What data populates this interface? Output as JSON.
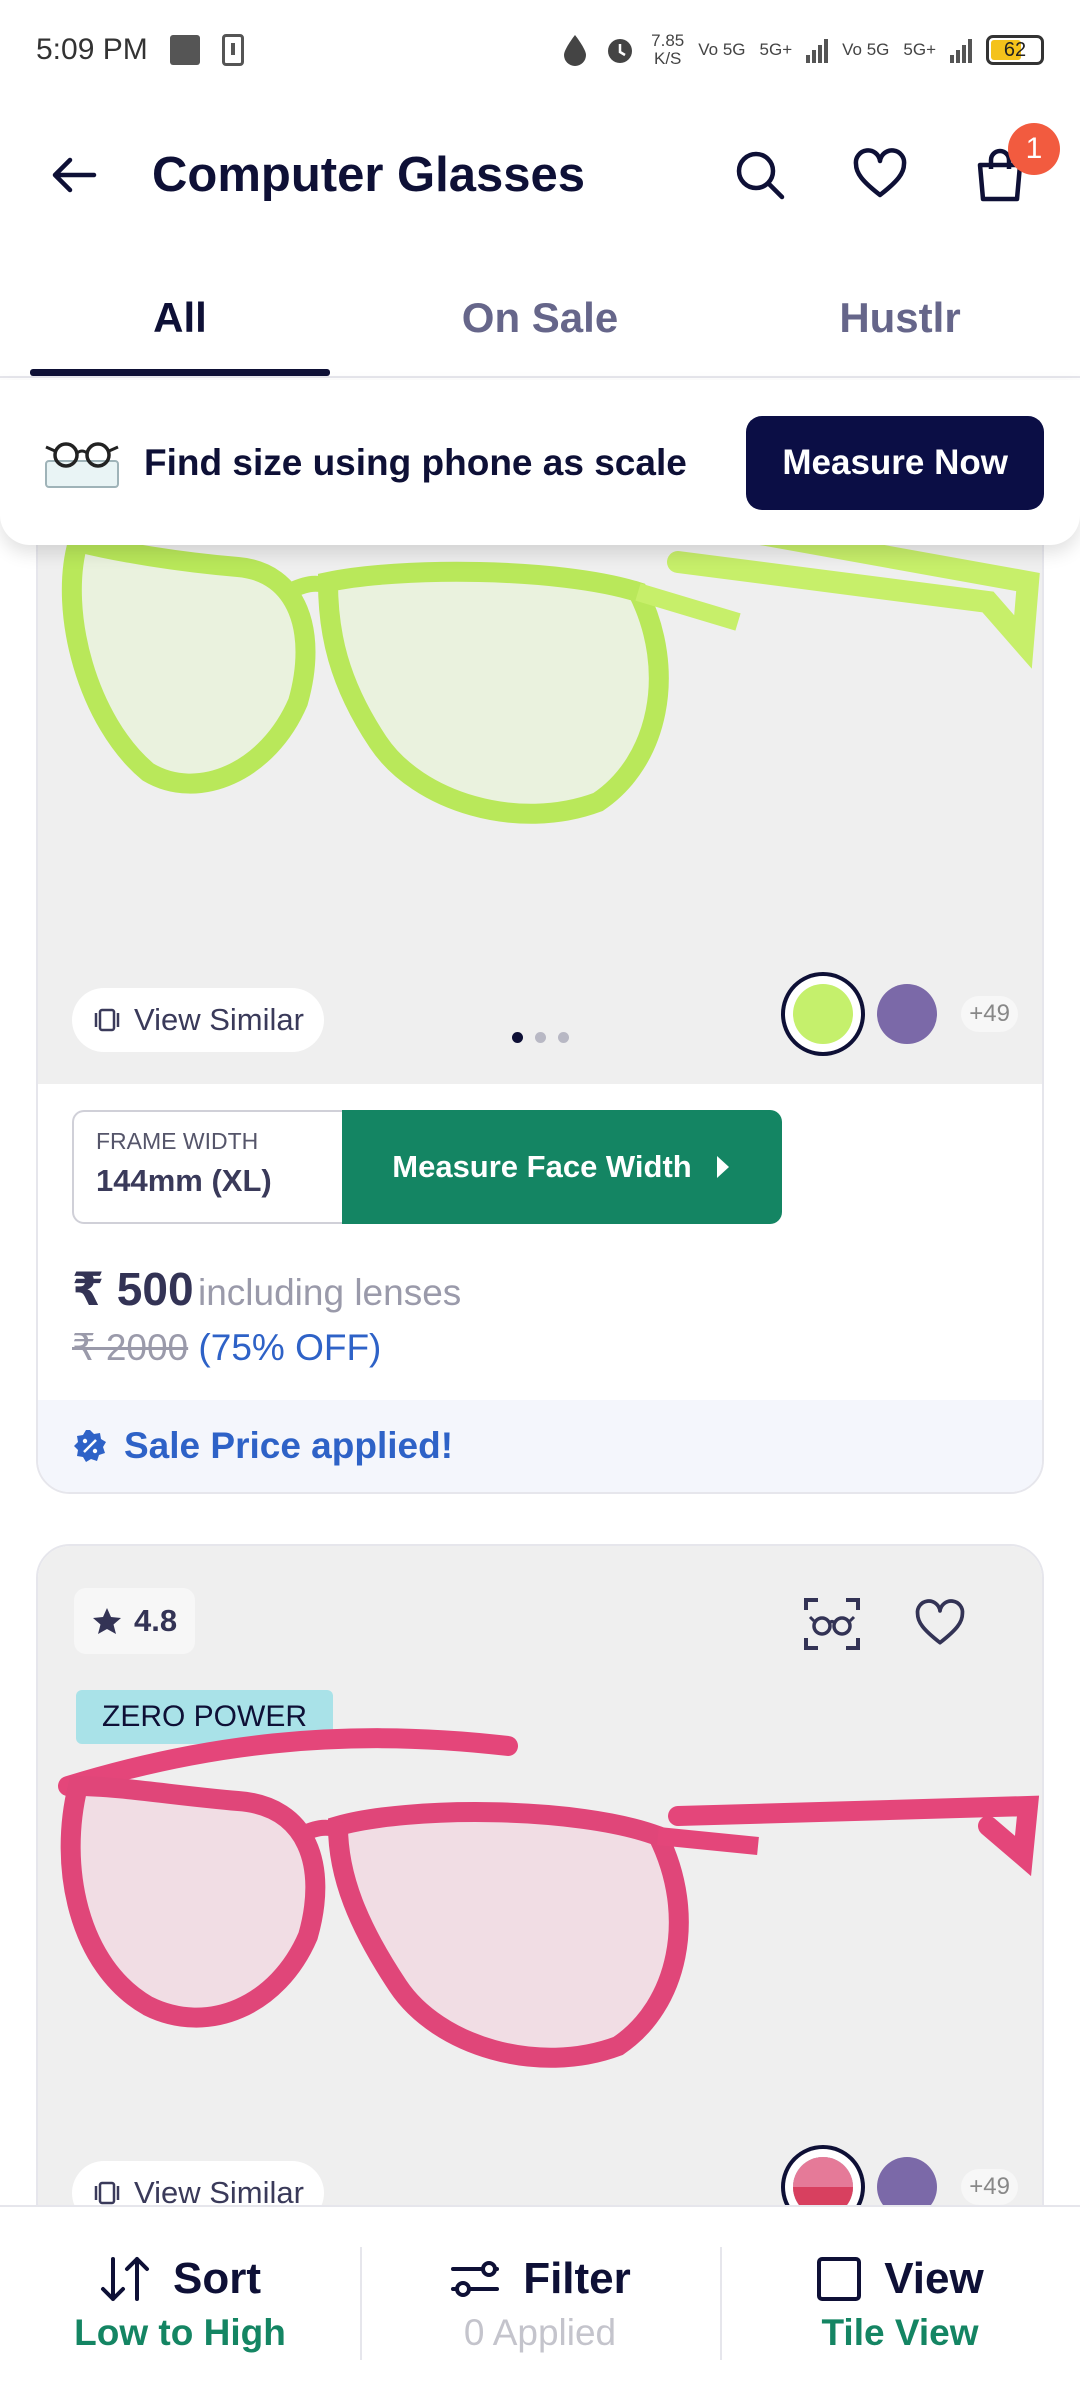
{
  "status_bar": {
    "time": "5:09 PM",
    "speed_value": "7.85",
    "speed_unit": "K/S",
    "sim1": "Vo 5G",
    "sim1_net": "5G+",
    "sim2": "Vo 5G",
    "sim2_net": "5G+",
    "battery": "62"
  },
  "header": {
    "title": "Computer Glasses",
    "cart_count": "1"
  },
  "tabs": [
    {
      "label": "All",
      "active": true
    },
    {
      "label": "On Sale",
      "active": false
    },
    {
      "label": "Hustlr",
      "active": false
    }
  ],
  "measure_banner": {
    "text": "Find size using phone as scale",
    "button": "Measure Now"
  },
  "products": [
    {
      "view_similar": "View Similar",
      "swatches": [
        "#c5f06c",
        "#7b69a8"
      ],
      "more_colors": "+49",
      "frame_width_label": "FRAME WIDTH",
      "frame_width_value": "144mm (XL)",
      "measure_button": "Measure Face Width",
      "price": "₹ 500",
      "price_note": "including lenses",
      "old_price": "₹ 2000",
      "discount": "(75% OFF)",
      "sale_text": "Sale Price applied!"
    },
    {
      "rating": "4.8",
      "tag": "ZERO POWER",
      "view_similar": "View Similar",
      "more_colors": "+49"
    }
  ],
  "bottom_bar": {
    "sort_label": "Sort",
    "sort_value": "Low to High",
    "filter_label": "Filter",
    "filter_value": "0 Applied",
    "view_label": "View",
    "view_value": "Tile View"
  },
  "colors": {
    "primary": "#0b0e45",
    "green": "#148563",
    "sale_blue": "#2e62c7",
    "badge": "#f25b3f"
  }
}
